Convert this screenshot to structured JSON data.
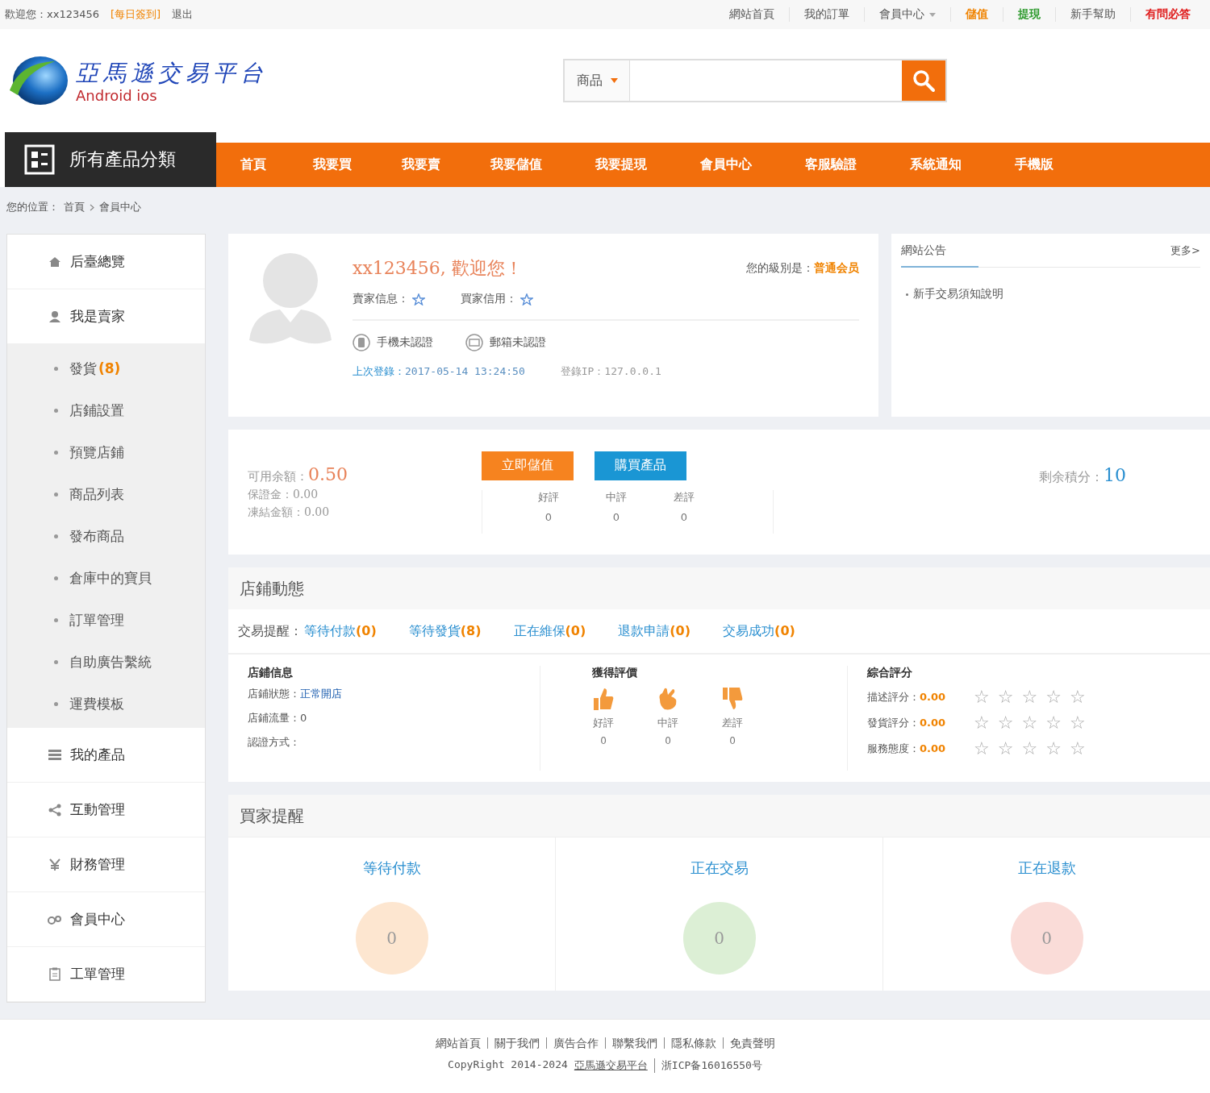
{
  "top_bar": {
    "greeting": "歡迎您：",
    "username": "xx123456",
    "sign_in": "[每日簽到]",
    "logout": "退出",
    "links": [
      {
        "label": "網站首頁",
        "color": "#555555",
        "dropdown": false,
        "bold": false
      },
      {
        "label": "我的訂單",
        "color": "#555555",
        "dropdown": false,
        "bold": false
      },
      {
        "label": "會員中心",
        "color": "#555555",
        "dropdown": true,
        "bold": false
      },
      {
        "label": "儲值",
        "color": "#f08300",
        "dropdown": false,
        "bold": true
      },
      {
        "label": "提現",
        "color": "#2e9a2e",
        "dropdown": false,
        "bold": true
      },
      {
        "label": "新手幫助",
        "color": "#555555",
        "dropdown": false,
        "bold": false
      },
      {
        "label": "有問必答",
        "color": "#e02020",
        "dropdown": false,
        "bold": true
      }
    ]
  },
  "logo": {
    "title": "亞馬遜交易平台",
    "subtitle": "Android ios"
  },
  "search": {
    "category": "商品"
  },
  "nav": {
    "category_button": "所有產品分類",
    "items": [
      "首頁",
      "我要買",
      "我要賣",
      "我要儲值",
      "我要提現",
      "會員中心",
      "客服驗證",
      "系統通知",
      "手機版"
    ]
  },
  "breadcrumb": {
    "label": "您的位置：",
    "items": [
      "首頁",
      "會員中心"
    ]
  },
  "sidebar": {
    "items": [
      {
        "label": "后臺總覽"
      },
      {
        "label": "我是賣家",
        "children": [
          {
            "label": "發貨",
            "count": "(8)"
          },
          {
            "label": "店鋪設置"
          },
          {
            "label": "預覽店鋪"
          },
          {
            "label": "商品列表"
          },
          {
            "label": "發布商品"
          },
          {
            "label": "倉庫中的寶貝"
          },
          {
            "label": "訂單管理"
          },
          {
            "label": "自助廣告繫統"
          },
          {
            "label": "運費模板"
          }
        ]
      },
      {
        "label": "我的產品"
      },
      {
        "label": "互動管理"
      },
      {
        "label": "財務管理"
      },
      {
        "label": "會員中心"
      },
      {
        "label": "工單管理"
      }
    ]
  },
  "profile": {
    "greeting": "xx123456, 歡迎您！",
    "level_label": "您的級別是：",
    "level": "普通会员",
    "seller_info": "賣家信息：",
    "buyer_credit": "買家信用：",
    "verifications": [
      "手機未認證",
      "郵箱未認證"
    ],
    "last_login_label": "上次登錄：",
    "last_login": "2017-05-14 13:24:50",
    "login_ip": "登錄IP：127.0.0.1"
  },
  "notice": {
    "title": "網站公告",
    "more": "更多>",
    "items": [
      "新手交易須知說明"
    ]
  },
  "balance": {
    "available_label": "可用余額：",
    "available": "0.50",
    "deposit_label": "保證金：",
    "deposit": "0.00",
    "frozen_label": "凍結金額：",
    "frozen": "0.00",
    "buttons": [
      {
        "label": "立即儲值",
        "color": "#f6831f"
      },
      {
        "label": "購買產品",
        "color": "#1a96d4"
      }
    ],
    "ratings": [
      {
        "label": "好評",
        "value": "0"
      },
      {
        "label": "中評",
        "value": "0"
      },
      {
        "label": "差評",
        "value": "0"
      }
    ],
    "points_label": "剩余積分：",
    "points": "10"
  },
  "shop": {
    "title": "店鋪動態",
    "reminder_label": "交易提醒：",
    "reminders": [
      {
        "label": "等待付款",
        "count": "(0)"
      },
      {
        "label": "等待發貨",
        "count": "(8)"
      },
      {
        "label": "正在維保",
        "count": "(0)"
      },
      {
        "label": "退款申請",
        "count": "(0)"
      },
      {
        "label": "交易成功",
        "count": "(0)"
      }
    ],
    "info": {
      "title": "店鋪信息",
      "rows": [
        {
          "label": "店鋪狀態：",
          "value": "正常開店"
        },
        {
          "label": "店鋪流量：",
          "value": "0"
        },
        {
          "label": "認證方式："
        }
      ]
    },
    "reviews": {
      "title": "獲得評價",
      "items": [
        {
          "label": "好評",
          "value": "0"
        },
        {
          "label": "中評",
          "value": "0"
        },
        {
          "label": "差評",
          "value": "0"
        }
      ]
    },
    "scores": {
      "title": "綜合評分",
      "rows": [
        {
          "label": "描述評分：",
          "value": "0.00",
          "stars": 0
        },
        {
          "label": "發貨評分：",
          "value": "0.00",
          "stars": 0
        },
        {
          "label": "服務態度：",
          "value": "0.00",
          "stars": 0
        }
      ]
    }
  },
  "buyer": {
    "title": "買家提醒",
    "items": [
      {
        "label": "等待付款",
        "value": "0",
        "color": "#fde6d0"
      },
      {
        "label": "正在交易",
        "value": "0",
        "color": "#dcefd5"
      },
      {
        "label": "正在退款",
        "value": "0",
        "color": "#fadcd8"
      }
    ]
  },
  "footer": {
    "links": [
      "網站首頁",
      "關于我們",
      "廣告合作",
      "聯繫我們",
      "隱私條款",
      "免責聲明"
    ],
    "copyright": "CopyRight 2014-2024",
    "site": "亞馬遜交易平台",
    "icp": "浙ICP备16016550号"
  }
}
